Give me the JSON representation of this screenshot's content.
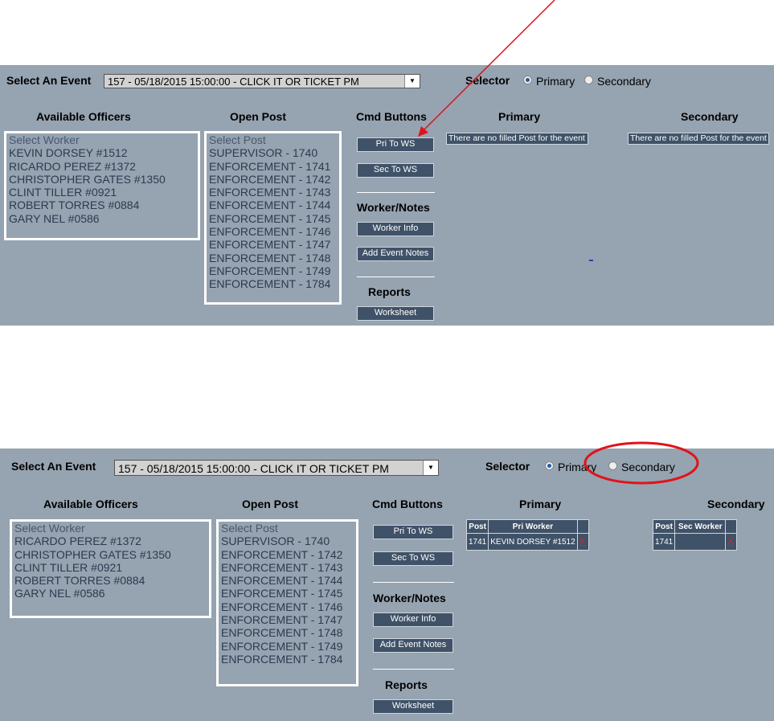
{
  "top": {
    "event_label": "Select An Event",
    "event_value": "157 - 05/18/2015 15:00:00 - CLICK IT OR TICKET PM",
    "selector_label": "Selector",
    "primary_label": "Primary",
    "secondary_label": "Secondary",
    "selected": "Primary",
    "officers_header": "Available Officers",
    "officers": [
      "Select Worker",
      "KEVIN DORSEY #1512",
      "RICARDO PEREZ #1372",
      "CHRISTOPHER GATES #1350",
      "CLINT TILLER #0921",
      "ROBERT TORRES #0884",
      "GARY NEL #0586"
    ],
    "posts_header": "Open Post",
    "posts": [
      "Select Post",
      "SUPERVISOR - 1740",
      "ENFORCEMENT - 1741",
      "ENFORCEMENT - 1742",
      "ENFORCEMENT - 1743",
      "ENFORCEMENT - 1744",
      "ENFORCEMENT - 1745",
      "ENFORCEMENT - 1746",
      "ENFORCEMENT - 1747",
      "ENFORCEMENT - 1748",
      "ENFORCEMENT - 1749",
      "ENFORCEMENT - 1784"
    ],
    "cmd_header": "Cmd Buttons",
    "pri_btn": "Pri To WS",
    "sec_btn": "Sec To WS",
    "worker_header": "Worker/Notes",
    "worker_info_btn": "Worker Info",
    "event_notes_btn": "Add Event Notes",
    "reports_header": "Reports",
    "worksheet_btn": "Worksheet",
    "primary_header": "Primary",
    "secondary_header": "Secondary",
    "primary_notice": "There are no filled Post for the event",
    "secondary_notice": "There are no filled Post for the event"
  },
  "bottom": {
    "event_label": "Select An Event",
    "event_value": "157 - 05/18/2015 15:00:00 - CLICK IT OR TICKET PM",
    "selector_label": "Selector",
    "primary_label": "Primary",
    "secondary_label": "Secondary",
    "selected": "Primary",
    "officers_header": "Available Officers",
    "officers": [
      "Select Worker",
      "RICARDO PEREZ #1372",
      "CHRISTOPHER GATES #1350",
      "CLINT TILLER #0921",
      "ROBERT TORRES #0884",
      "GARY NEL #0586"
    ],
    "posts_header": "Open Post",
    "posts": [
      "Select Post",
      "SUPERVISOR - 1740",
      "ENFORCEMENT - 1742",
      "ENFORCEMENT - 1743",
      "ENFORCEMENT - 1744",
      "ENFORCEMENT - 1745",
      "ENFORCEMENT - 1746",
      "ENFORCEMENT - 1747",
      "ENFORCEMENT - 1748",
      "ENFORCEMENT - 1749",
      "ENFORCEMENT - 1784"
    ],
    "cmd_header": "Cmd Buttons",
    "pri_btn": "Pri To WS",
    "sec_btn": "Sec To WS",
    "worker_header": "Worker/Notes",
    "worker_info_btn": "Worker Info",
    "event_notes_btn": "Add Event Notes",
    "reports_header": "Reports",
    "worksheet_btn": "Worksheet",
    "primary_header": "Primary",
    "secondary_header": "Secondary",
    "primary_table": {
      "columns": [
        "Post",
        "Pri Worker",
        ""
      ],
      "rows": [
        {
          "post": "1741",
          "worker": "KEVIN DORSEY #1512",
          "action": "X"
        }
      ]
    },
    "secondary_table": {
      "columns": [
        "Post",
        "Sec Worker",
        ""
      ],
      "rows": [
        {
          "post": "1741",
          "worker": "",
          "action": "X"
        }
      ]
    }
  },
  "annotation_colors": {
    "arrow": "#e0131a",
    "ellipse": "#e0131a"
  }
}
